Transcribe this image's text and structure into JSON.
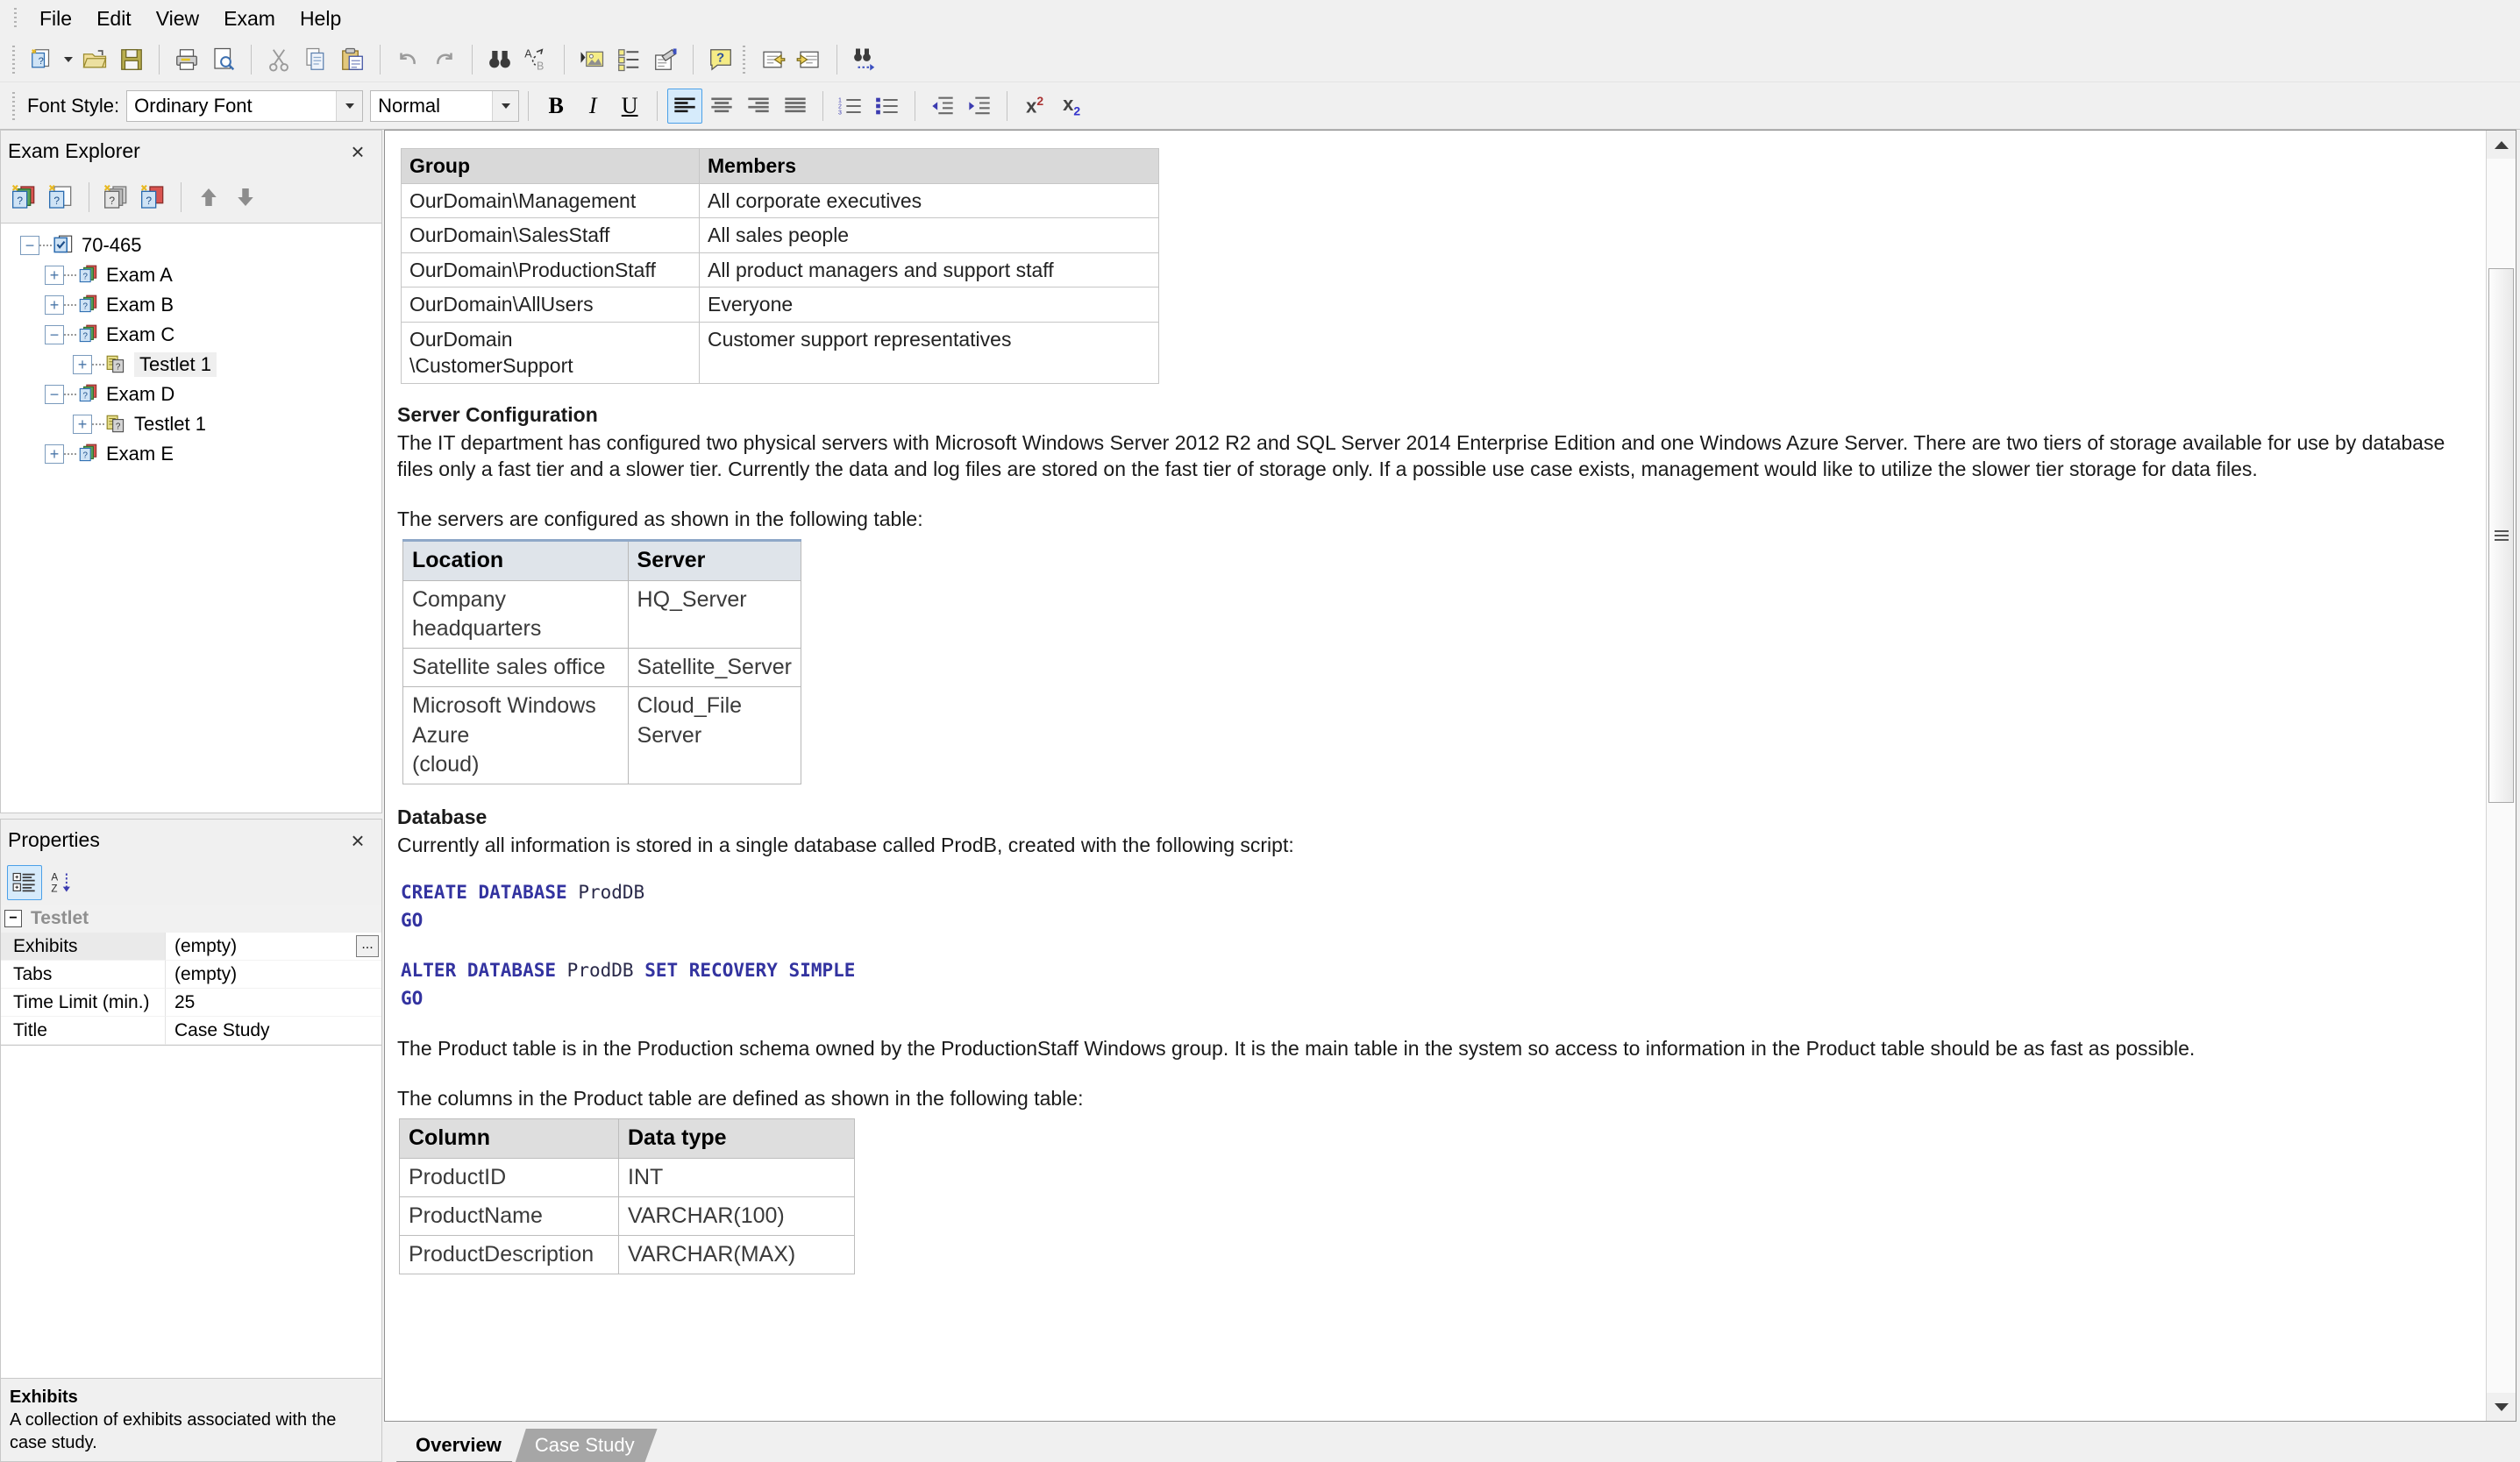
{
  "menubar": {
    "items": [
      {
        "label": "File",
        "name": "menu-file"
      },
      {
        "label": "Edit",
        "name": "menu-edit"
      },
      {
        "label": "View",
        "name": "menu-view"
      },
      {
        "label": "Exam",
        "name": "menu-exam"
      },
      {
        "label": "Help",
        "name": "menu-help"
      }
    ]
  },
  "toolbar_main": {
    "buttons": [
      {
        "icon": "new-exam-icon",
        "label": "New"
      },
      {
        "icon": "open-folder-icon",
        "label": "Open"
      },
      {
        "icon": "save-disk-icon",
        "label": "Save"
      },
      {
        "icon": "print-icon",
        "label": "Print"
      },
      {
        "icon": "print-preview-icon",
        "label": "Print Preview"
      },
      {
        "icon": "cut-scissors-icon",
        "label": "Cut"
      },
      {
        "icon": "copy-icon",
        "label": "Copy"
      },
      {
        "icon": "paste-icon",
        "label": "Paste"
      },
      {
        "icon": "undo-icon",
        "label": "Undo"
      },
      {
        "icon": "redo-icon",
        "label": "Redo"
      },
      {
        "icon": "find-binoculars-icon",
        "label": "Find"
      },
      {
        "icon": "replace-icon",
        "label": "Replace"
      },
      {
        "icon": "insert-image-icon",
        "label": "Insert Image"
      },
      {
        "icon": "properties-list-icon",
        "label": "Properties"
      },
      {
        "icon": "edit-note-icon",
        "label": "Edit Note"
      },
      {
        "icon": "help-question-icon",
        "label": "Help"
      },
      {
        "icon": "previous-question-icon",
        "label": "Previous"
      },
      {
        "icon": "next-question-icon",
        "label": "Next"
      },
      {
        "icon": "find-next-icon",
        "label": "Find Next"
      }
    ]
  },
  "toolbar_format": {
    "font_style_label": "Font Style:",
    "font_style_value": "Ordinary Font",
    "font_weight_value": "Normal",
    "buttons": [
      {
        "icon": "bold-icon",
        "label": "B",
        "active": false
      },
      {
        "icon": "italic-icon",
        "label": "I",
        "active": false
      },
      {
        "icon": "underline-icon",
        "label": "U",
        "active": false
      },
      {
        "icon": "align-left-icon",
        "label": "Align Left",
        "active": true
      },
      {
        "icon": "align-center-icon",
        "label": "Align Center",
        "active": false
      },
      {
        "icon": "align-right-icon",
        "label": "Align Right",
        "active": false
      },
      {
        "icon": "align-justify-icon",
        "label": "Justify",
        "active": false
      },
      {
        "icon": "numbered-list-icon",
        "label": "Numbered List",
        "active": false
      },
      {
        "icon": "bulleted-list-icon",
        "label": "Bulleted List",
        "active": false
      },
      {
        "icon": "decrease-indent-icon",
        "label": "Decrease Indent",
        "active": false
      },
      {
        "icon": "increase-indent-icon",
        "label": "Increase Indent",
        "active": false
      },
      {
        "icon": "superscript-icon",
        "label": "x",
        "sup": "2",
        "active": false
      },
      {
        "icon": "subscript-icon",
        "label": "x",
        "sub": "2",
        "active": false
      }
    ]
  },
  "exam_explorer": {
    "title": "Exam Explorer",
    "close_label": "×",
    "toolbar": [
      {
        "icon": "new-exam-group-icon",
        "label": "New Exam"
      },
      {
        "icon": "new-question-icon",
        "label": "New Question"
      },
      {
        "icon": "new-testlet-icon",
        "label": "New Testlet"
      },
      {
        "icon": "new-case-study-icon",
        "label": "New Case Study"
      },
      {
        "icon": "move-up-arrow-icon",
        "label": "Move Up"
      },
      {
        "icon": "move-down-arrow-icon",
        "label": "Move Down"
      }
    ],
    "tree": [
      {
        "label": "70-465",
        "level": 0,
        "expander": "−",
        "icon": "exam-root-icon",
        "selected": false
      },
      {
        "label": "Exam A",
        "level": 1,
        "expander": "+",
        "icon": "exam-icon",
        "selected": false
      },
      {
        "label": "Exam B",
        "level": 1,
        "expander": "+",
        "icon": "exam-icon",
        "selected": false
      },
      {
        "label": "Exam C",
        "level": 1,
        "expander": "−",
        "icon": "exam-icon",
        "selected": false
      },
      {
        "label": "Testlet 1",
        "level": 2,
        "expander": "+",
        "icon": "testlet-icon",
        "selected": true
      },
      {
        "label": "Exam D",
        "level": 1,
        "expander": "−",
        "icon": "exam-icon",
        "selected": false
      },
      {
        "label": "Testlet 1",
        "level": 2,
        "expander": "+",
        "icon": "testlet-icon",
        "selected": false
      },
      {
        "label": "Exam E",
        "level": 1,
        "expander": "+",
        "icon": "exam-icon",
        "selected": false
      }
    ]
  },
  "properties": {
    "title": "Properties",
    "close_label": "×",
    "toolbar": [
      {
        "icon": "categorized-view-icon",
        "label": "Categorized",
        "active": true
      },
      {
        "icon": "alphabetical-sort-icon",
        "label": "Alphabetical",
        "active": false
      }
    ],
    "category": "Testlet",
    "category_expander": "−",
    "rows": [
      {
        "key": "Exhibits",
        "value": "(empty)",
        "has_ellipsis": true,
        "selected": true,
        "ellipsis_label": "..."
      },
      {
        "key": "Tabs",
        "value": "(empty)",
        "has_ellipsis": false,
        "selected": false
      },
      {
        "key": "Time Limit (min.)",
        "value": "25",
        "has_ellipsis": false,
        "selected": false
      },
      {
        "key": "Title",
        "value": "Case Study",
        "has_ellipsis": false,
        "selected": false
      }
    ],
    "description": {
      "title": "Exhibits",
      "text": "A collection of exhibits associated with the case study."
    }
  },
  "document": {
    "groups_table": {
      "headers": [
        "Group",
        "Members"
      ],
      "rows": [
        [
          "OurDomain\\Management",
          "All corporate executives"
        ],
        [
          "OurDomain\\SalesStaff",
          "All sales people"
        ],
        [
          "OurDomain\\ProductionStaff",
          "All product managers and support staff"
        ],
        [
          "OurDomain\\AllUsers",
          "Everyone"
        ],
        [
          "OurDomain\n\\CustomerSupport",
          "Customer support representatives"
        ]
      ]
    },
    "server_config": {
      "heading": "Server Configuration",
      "paragraph": "The IT department has configured two physical servers with Microsoft Windows Server 2012 R2 and SQL Server 2014 Enterprise Edition and one Windows Azure Server. There are two tiers of storage available for use by database files only a fast tier and a slower tier. Currently the data and log files are stored on the fast tier of storage only. If a possible use case exists, management would like to utilize the slower tier storage for data files.",
      "intro": "The servers are configured as shown in the following table:",
      "table": {
        "headers": [
          "Location",
          "Server"
        ],
        "rows": [
          [
            "Company headquarters",
            "HQ_Server"
          ],
          [
            "Satellite sales office",
            "Satellite_Server"
          ],
          [
            "Microsoft Windows Azure\n(cloud)",
            "Cloud_File Server"
          ]
        ]
      }
    },
    "database": {
      "heading": "Database",
      "paragraph": "Currently all information is stored in a single database called ProdB, created with the following script:",
      "sql_block_1": [
        {
          "kw": "CREATE DATABASE",
          "id": "ProdDB"
        },
        {
          "kw": "GO",
          "id": ""
        }
      ],
      "sql_block_2": [
        {
          "kw1": "ALTER DATABASE",
          "id": "ProdDB",
          "kw2": "SET RECOVERY SIMPLE"
        },
        {
          "kw1": "GO",
          "id": "",
          "kw2": ""
        }
      ],
      "paragraph2": "The Product table is in the Production schema owned by the ProductionStaff Windows group. It is the main table in the system so access to information in the Product table should be as fast as possible.",
      "paragraph3": "The columns in the Product table are defined as shown in the following table:",
      "columns_table": {
        "headers": [
          "Column",
          "Data type"
        ],
        "rows": [
          [
            "ProductID",
            "INT"
          ],
          [
            "ProductName",
            "VARCHAR(100)"
          ],
          [
            "ProductDescription",
            "VARCHAR(MAX)"
          ]
        ]
      }
    }
  },
  "doc_tabs": [
    {
      "label": "Overview",
      "active": true
    },
    {
      "label": "Case Study",
      "active": false
    }
  ],
  "colors": {
    "window_bg": "#f0f0f0",
    "accent_blue": "#4ba0e8",
    "table_header_gray": "#d9d9d9",
    "table_header_blue": "#dfe4ea",
    "sql_keyword": "#3333a0",
    "tab_inactive": "#a6a6a6"
  }
}
